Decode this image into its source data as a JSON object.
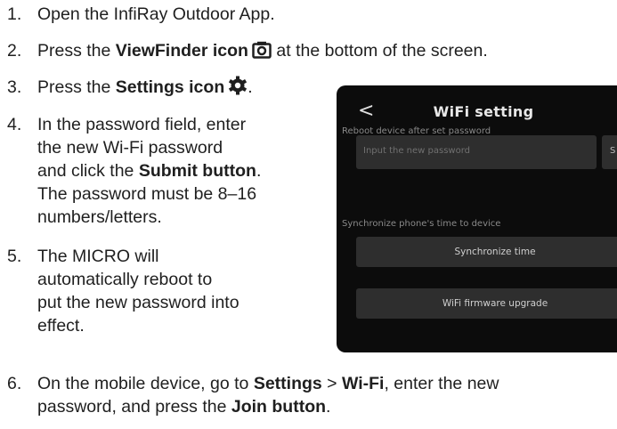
{
  "steps": [
    {
      "num": "1.",
      "parts": [
        "Open the InfiRay Outdoor App."
      ]
    },
    {
      "num": "2.",
      "pre": "Press the ",
      "bold": "ViewFinder icon",
      "post": " at the bottom of the screen."
    },
    {
      "num": "3.",
      "pre": "Press the ",
      "bold": "Settings icon",
      "post": "."
    },
    {
      "num": "4.",
      "line1": "In the password field, enter",
      "line2": "the new Wi-Fi password",
      "line3_pre": "and click the ",
      "line3_bold": "Submit button",
      "line3_post": ".",
      "line4": "The password must be 8–16",
      "line5": "numbers/letters."
    },
    {
      "num": "5.",
      "line1": "The MICRO will",
      "line2": "automatically reboot to",
      "line3": "put the new password into",
      "line4": "effect."
    },
    {
      "num": "6.",
      "pre": "On the mobile device, go to ",
      "b1": "Settings",
      "mid": " > ",
      "b2": "Wi-Fi",
      "post": ", enter the new",
      "line2_pre": "password, and press the ",
      "line2_bold": "Join button",
      "line2_post": "."
    }
  ],
  "phone": {
    "back": "<",
    "title": "WiFi setting",
    "label_reboot": "Reboot device after set password",
    "input_placeholder": "Input the new password",
    "submit_label": "S",
    "label_sync": "Synchronize phone's time to device",
    "sync_button": "Synchronize time",
    "upgrade_button": "WiFi firmware upgrade"
  },
  "icons": {
    "viewfinder": "viewfinder-icon",
    "settings": "settings-gear-icon"
  }
}
